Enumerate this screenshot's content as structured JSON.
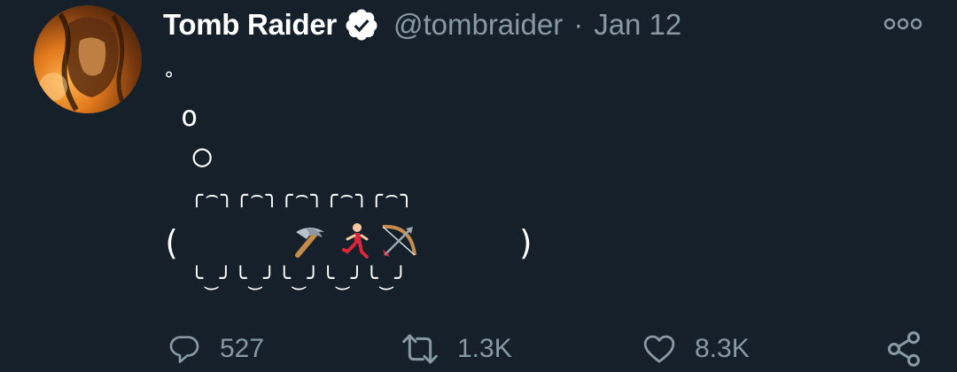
{
  "tweet": {
    "display_name": "Tomb Raider",
    "handle": "@tombraider",
    "separator": "·",
    "date": "Jan 12",
    "body_lines": [
      "°",
      "o",
      "◯",
      "  ╭⌢╮╭⌢╮╭⌢╮╭⌢╮╭⌢╮",
      "(                   )",
      "  ╰‿╯╰‿╯╰‿╯╰‿╯╰‿╯"
    ],
    "emojis": [
      "pickaxe",
      "person-running",
      "bow-and-arrow"
    ]
  },
  "actions": {
    "replies": "527",
    "retweets": "1.3K",
    "likes": "8.3K"
  },
  "colors": {
    "background": "#15202b",
    "muted": "#8899a6",
    "text": "#ffffff"
  }
}
